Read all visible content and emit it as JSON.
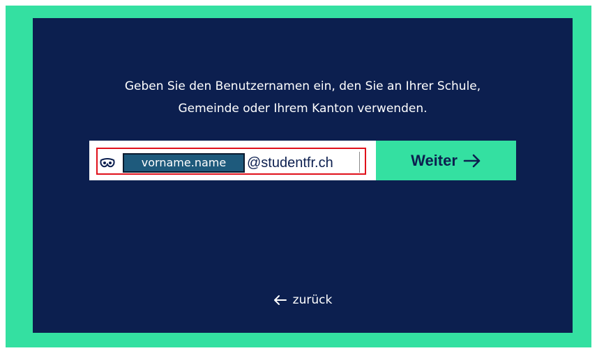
{
  "prompt": {
    "line1": "Geben Sie den Benutzernamen ein, den Sie an Ihrer Schule,",
    "line2": "Gemeinde oder Ihrem Kanton verwenden."
  },
  "login": {
    "username_value": "vorname.name",
    "domain_suffix": "@studentfr.ch",
    "user_icon": "user-mask-icon"
  },
  "next_button": {
    "label": "Weiter",
    "icon": "arrow-right-icon"
  },
  "back_link": {
    "label": "zurück",
    "icon": "arrow-left-icon"
  },
  "colors": {
    "panel_bg": "#0c1f4f",
    "accent": "#34e0a1",
    "highlight_border": "#e0101a",
    "field_fill": "#1e5a7c"
  }
}
